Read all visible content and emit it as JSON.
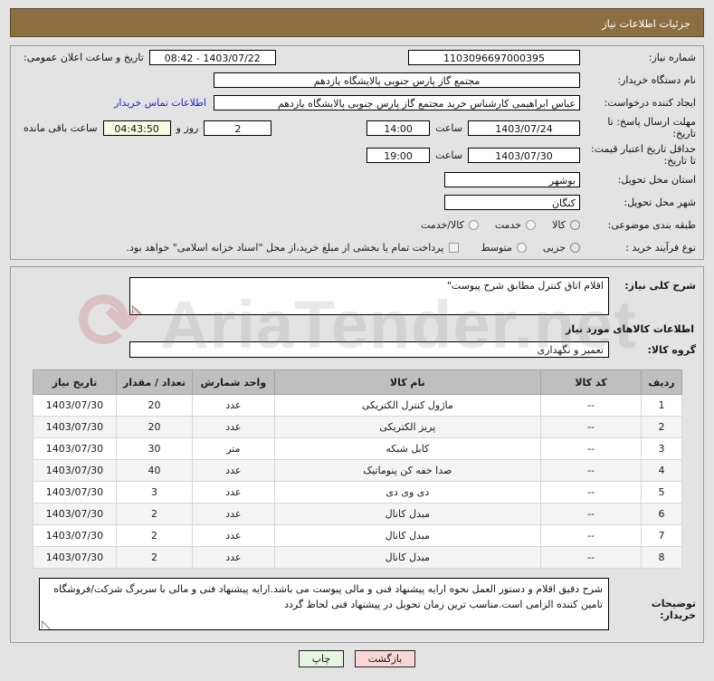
{
  "header": {
    "title": "جزئیات اطلاعات نیاز"
  },
  "form": {
    "need_number_label": "شماره نیاز:",
    "need_number_value": "1103096697000395",
    "public_announce_label": "تاریخ و ساعت اعلان عمومی:",
    "public_announce_value": "1403/07/22 - 08:42",
    "buyer_org_label": "نام دستگاه خریدار:",
    "buyer_org_value": "مجتمع گاز پارس جنوبی  پالایشگاه یازدهم",
    "creator_label": "ایجاد کننده درخواست:",
    "creator_value": "عباس ابراهیمی کارشناس خرید مجتمع گاز پارس جنوبی  پالایشگاه یازدهم",
    "contact_link": "اطلاعات تماس خریدار",
    "deadline_label": "مهلت ارسال پاسخ: تا تاریخ:",
    "deadline_date": "1403/07/24",
    "hour_label": "ساعت",
    "deadline_time": "14:00",
    "remaining_days": "2",
    "remaining_days_unit": "روز و",
    "remaining_clock": "04:43:50",
    "remaining_suffix": "ساعت باقی مانده",
    "price_validity_label": "حداقل تاریخ اعتبار قیمت: تا تاریخ:",
    "price_validity_date": "1403/07/30",
    "price_validity_time": "19:00",
    "province_label": "استان محل تحویل:",
    "province_value": "بوشهر",
    "city_label": "شهر محل تحویل:",
    "city_value": "کنگان",
    "category_label": "طبقه بندی موضوعی:",
    "category_options": [
      "کالا",
      "خدمت",
      "کالا/خدمت"
    ],
    "category_selected": "کالا",
    "process_label": "نوع فرآیند خرید :",
    "process_options": [
      "جزیی",
      "متوسط"
    ],
    "process_selected": "جزیی",
    "treasury_checkbox_label": "پرداخت تمام یا بخشی از مبلغ خرید،از محل \"اسناد خزانه اسلامی\" خواهد بود.",
    "treasury_checked": false
  },
  "description": {
    "label": "شرح کلی نیاز:",
    "value": "اقلام اتاق کنترل مطابق شرح پیوست\""
  },
  "goods_section": {
    "title": "اطلاعات کالاهای مورد نیاز",
    "group_label": "گروه کالا:",
    "group_value": "تعمیر و نگهداری"
  },
  "items_table": {
    "columns": [
      "ردیف",
      "کد کالا",
      "نام کالا",
      "واحد شمارش",
      "تعداد / مقدار",
      "تاریخ نیاز"
    ],
    "rows": [
      {
        "idx": "1",
        "code": "--",
        "name": "ماژول کنترل الکتریکی",
        "unit": "عدد",
        "qty": "20",
        "date": "1403/07/30"
      },
      {
        "idx": "2",
        "code": "--",
        "name": "پریز الکتریکی",
        "unit": "عدد",
        "qty": "20",
        "date": "1403/07/30"
      },
      {
        "idx": "3",
        "code": "--",
        "name": "کابل شبکه",
        "unit": "متر",
        "qty": "30",
        "date": "1403/07/30"
      },
      {
        "idx": "4",
        "code": "--",
        "name": "صدا خفه کن پنوماتیک",
        "unit": "عدد",
        "qty": "40",
        "date": "1403/07/30"
      },
      {
        "idx": "5",
        "code": "--",
        "name": "دی وی دی",
        "unit": "عدد",
        "qty": "3",
        "date": "1403/07/30"
      },
      {
        "idx": "6",
        "code": "--",
        "name": "مبدل کانال",
        "unit": "عدد",
        "qty": "2",
        "date": "1403/07/30"
      },
      {
        "idx": "7",
        "code": "--",
        "name": "مبدل کانال",
        "unit": "عدد",
        "qty": "2",
        "date": "1403/07/30"
      },
      {
        "idx": "8",
        "code": "--",
        "name": "مبدل کانال",
        "unit": "عدد",
        "qty": "2",
        "date": "1403/07/30"
      }
    ]
  },
  "buyer_notes": {
    "label": "توضیحات خریدار:",
    "value": "شرح دقیق اقلام و دستور العمل نحوه ارایه پیشنهاد فنی و مالی پیوست می باشد.ارایه پیشنهاد فنی و مالی با سربرگ شرکت/فروشگاه تامین کننده الزامی است.مناسب ترین زمان تحویل در پیشنهاد فنی لحاظ گردد"
  },
  "footer": {
    "print_label": "چاپ",
    "back_label": "بازگشت"
  },
  "watermark": {
    "text": "AriaTender.net"
  }
}
